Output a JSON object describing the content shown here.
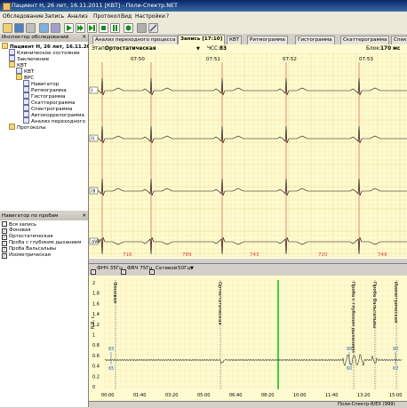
{
  "window": {
    "title": "Пациент Н, 26 лет, 16.11.2011 [КВТ] - Поли-Спектр.NET"
  },
  "menu": [
    "Обследование",
    "Запись",
    "Анализ",
    "Протокол",
    "Вид",
    "Настройки",
    "?"
  ],
  "toolbar_icons": [
    "open-icon",
    "save-icon",
    "print-icon",
    "search-icon",
    "settings-icon",
    "play-icon",
    "fast-forward-icon",
    "skip-forward-icon",
    "stop-icon",
    "pause-icon",
    "record-icon",
    "camera-icon",
    "wrench-icon"
  ],
  "inspector": {
    "title": "Инспектор обследований",
    "root": "Пациент Н, 26 лет, 16.11.2011",
    "items": [
      "Клиническое состояние",
      "Заключение",
      "КВТ",
      "КВТ",
      "ВРС",
      "Навигатор",
      "Ритмограмма",
      "Гистограмма",
      "Скаттерограмма",
      "Спектрограмма",
      "Автокоррелограмма",
      "Анализ переходного",
      "Протоколы"
    ]
  },
  "navigator": {
    "title": "Навигатор по пробам",
    "items": [
      {
        "label": "Вся запись",
        "checked": false
      },
      {
        "label": "Фоновая",
        "checked": true
      },
      {
        "label": "Ортостатическая",
        "checked": true
      },
      {
        "label": "Проба с глубоким дыханием",
        "checked": true
      },
      {
        "label": "Проба Вальсальвы",
        "checked": true
      },
      {
        "label": "Изометрическая",
        "checked": true
      }
    ]
  },
  "tabs": [
    "Анализ переходного процесса",
    "Запись [17:10]",
    "КВТ",
    "Ритмограмма",
    "Гистограмма",
    "Скаттерограмма",
    "Спектрограмма"
  ],
  "ecg": {
    "stage_label": "Этап:",
    "stage_value": "Ортостатическая",
    "hr_label": "ЧСС:",
    "hr_value": "83",
    "block_label": "Блок:",
    "block_value": "170 мс",
    "times": [
      "07:50",
      "07:51",
      "07:52",
      "07:53"
    ],
    "leads": [
      "I",
      "II",
      "III",
      "aVR"
    ],
    "rr_values": [
      "716",
      "789",
      "743",
      "720",
      "749"
    ]
  },
  "filters": {
    "fhch_label": "ФНЧ 35Гц",
    "fvch_label": "ФВЧ 75Гц",
    "net_label": "Сетевой",
    "net_value": "50Гц"
  },
  "trend": {
    "y_axis_label": "R-R, с",
    "y_ticks": [
      "2",
      "1.8",
      "1.6",
      "1.4",
      "1.2",
      "1",
      "0.8",
      "0.6",
      "0.4",
      "0.2",
      "0"
    ],
    "x_ticks": [
      "00:00",
      "01:40",
      "03:20",
      "05:00",
      "06:40",
      "08:20",
      "10:00",
      "11:40",
      "13:20",
      "15:00"
    ],
    "markers": [
      "Фоновая",
      "Ортостатическая",
      "Проба с глубоким дыханием",
      "Проба Вальсальвы",
      "Изометрическая"
    ],
    "annotations": [
      {
        "top": "83",
        "bottom": "65"
      },
      {
        "top": "90",
        "bottom": "60"
      },
      {
        "top": "90",
        "bottom": "62"
      }
    ]
  },
  "status": {
    "device": "Поли-Спектр-8/EX (999)"
  }
}
